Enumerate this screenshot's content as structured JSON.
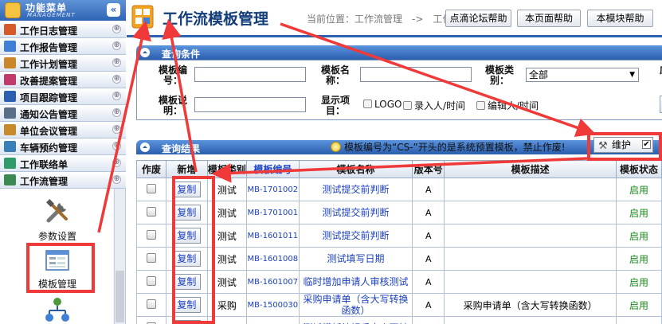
{
  "sidebar": {
    "title": "功能菜单",
    "subtitle": "MANAGEMENT",
    "collapse": "«",
    "items": [
      {
        "label": "工作日志管理",
        "color": "#d45a2a"
      },
      {
        "label": "工作报告管理",
        "color": "#3f7fd6"
      },
      {
        "label": "工作计划管理",
        "color": "#c9872a"
      },
      {
        "label": "改善提案管理",
        "color": "#c03a6a"
      },
      {
        "label": "项目跟踪管理",
        "color": "#2d5fb1"
      },
      {
        "label": "通知公告管理",
        "color": "#5a6e8a"
      },
      {
        "label": "单位会议管理",
        "color": "#c78a2a"
      },
      {
        "label": "车辆预约管理",
        "color": "#3a7fb8"
      },
      {
        "label": "工作联络单",
        "color": "#2f9c6a"
      },
      {
        "label": "工作流管理",
        "color": "#3c8a52"
      }
    ],
    "expand_symbol": "⊕",
    "tools": [
      {
        "label": "参数设置",
        "icon": "tools-icon"
      },
      {
        "label": "模板管理",
        "icon": "form-template-icon"
      },
      {
        "label": "",
        "icon": "workflow-icon"
      }
    ]
  },
  "header": {
    "title": "工作流模板管理",
    "breadcrumb": "当前位置：工作流管理　->　工作流",
    "buttons": [
      "点滴论坛帮助",
      "本页面帮助",
      "本模块帮助"
    ]
  },
  "query": {
    "section_title": "查询条件",
    "fields": {
      "code_label": "模板编号：",
      "name_label": "模板名称：",
      "type_label": "模板类别：",
      "type_value": "全部",
      "desc_label": "模板说明：",
      "display_label": "显示项目：",
      "checks": [
        "LOGO",
        "录入人/时间",
        "编辑人/时间"
      ],
      "cut_char": "应"
    }
  },
  "results": {
    "section_title": "查询结果",
    "notice": "模板编号为“CS-”开头的是系统预置模板，禁止作废!",
    "maintain_label": "维护",
    "maintain_checked": "✔",
    "columns": [
      "作废",
      "新增",
      "模板类别",
      "模板编号",
      "模板名称",
      "版本号",
      "模板描述",
      "模板状态"
    ],
    "copy_label": "复制",
    "rows": [
      {
        "category": "测试",
        "code": "MB-1701002",
        "name": "测试提交前判断",
        "version": "A",
        "desc": "",
        "status": "启用"
      },
      {
        "category": "测试",
        "code": "MB-1701001",
        "name": "测试提交前判断",
        "version": "A",
        "desc": "",
        "status": "启用"
      },
      {
        "category": "测试",
        "code": "MB-1601011",
        "name": "测试提交前判断",
        "version": "A",
        "desc": "",
        "status": "启用"
      },
      {
        "category": "测试",
        "code": "MB-1601008",
        "name": "测试填写日期",
        "version": "A",
        "desc": "",
        "status": "启用"
      },
      {
        "category": "测试",
        "code": "MB-1601007",
        "name": "临时增加申请人审核测试",
        "version": "A",
        "desc": "",
        "status": "启用"
      },
      {
        "category": "采购",
        "code": "MB-1500030",
        "name": "采购申请单（含大写转换函数）",
        "version": "A",
        "desc": "采购申请单（含大写转换函数）",
        "status": "启用"
      },
      {
        "category": "",
        "code": "MB-",
        "name": "测试模板编辑后大小写转",
        "version": "",
        "desc": "",
        "status": ""
      }
    ]
  },
  "colors": {
    "accent_blue": "#2d62b0",
    "annotation_red": "#f03a3a",
    "enabled_green": "#1a8a1a"
  }
}
